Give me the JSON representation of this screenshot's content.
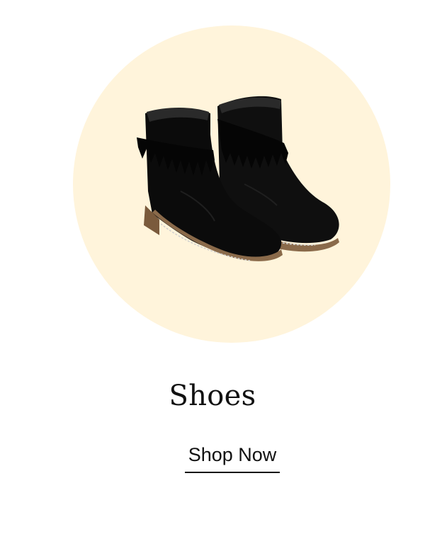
{
  "category": {
    "title": "Shoes",
    "image_subject": "black-suede-fringe-ankle-boots"
  },
  "cta": {
    "label": "Shop Now"
  },
  "colors": {
    "circle_background": "#fff4db",
    "text": "#111111",
    "page_background": "#ffffff"
  }
}
